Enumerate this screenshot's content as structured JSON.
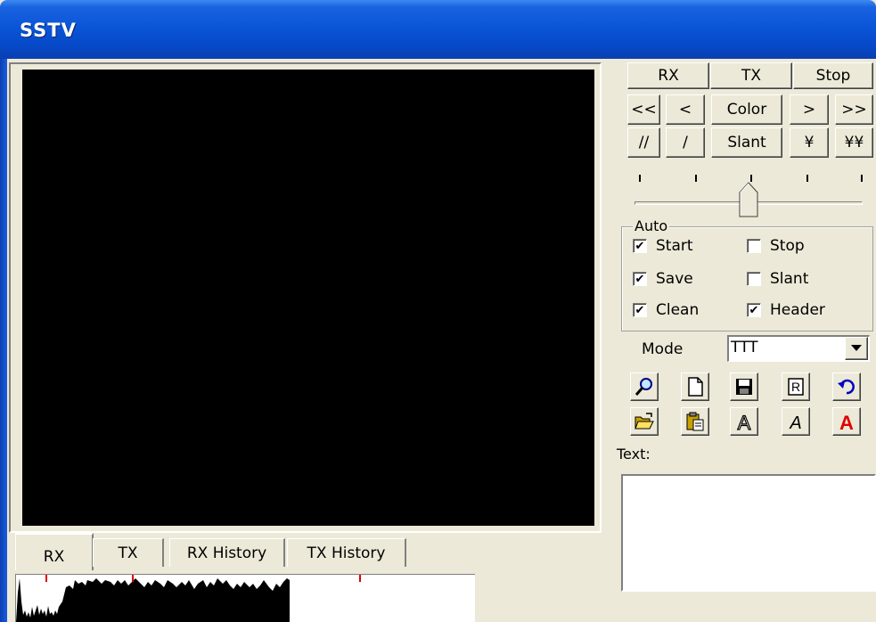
{
  "window": {
    "title": "SSTV"
  },
  "control_buttons": {
    "rx": "RX",
    "tx": "TX",
    "stop": "Stop",
    "fast_back": "<<",
    "back": "<",
    "color": "Color",
    "forward": ">",
    "fast_forward": ">>",
    "slant_left_fast": "//",
    "slant_left": "/",
    "slant": "Slant",
    "yen": "¥",
    "yen_double": "¥¥"
  },
  "slider": {
    "value": 0.5
  },
  "auto": {
    "legend": "Auto",
    "start": {
      "label": "Start",
      "checked": "✔"
    },
    "stop": {
      "label": "Stop",
      "checked": ""
    },
    "save": {
      "label": "Save",
      "checked": "✔"
    },
    "slant": {
      "label": "Slant",
      "checked": ""
    },
    "clean": {
      "label": "Clean",
      "checked": "✔"
    },
    "header": {
      "label": "Header",
      "checked": "✔"
    }
  },
  "mode": {
    "label": "Mode",
    "value": "TTT"
  },
  "tools": {
    "icons": [
      "magnifier-icon",
      "new-document-icon",
      "save-disk-icon",
      "r-box-icon",
      "undo-icon",
      "open-folder-icon",
      "paste-clipboard-icon",
      "font-outline-icon",
      "font-italic-icon",
      "font-color-icon"
    ],
    "font_letter": "A",
    "r_letter": "R"
  },
  "text": {
    "label": "Text:"
  },
  "tabs": {
    "rx": "RX",
    "tx": "TX",
    "rx_history": "RX History",
    "tx_history": "TX History"
  },
  "colors": {
    "titlebar": "#0648c6",
    "marker": "#e00000",
    "font_color_icon": "#e00000"
  }
}
